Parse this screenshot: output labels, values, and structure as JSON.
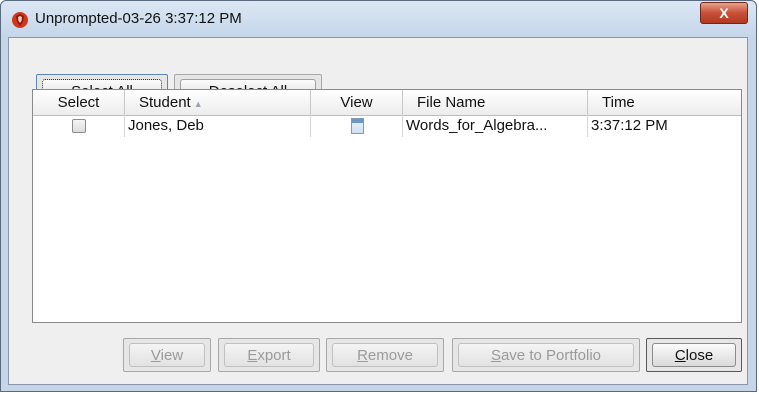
{
  "window": {
    "title": "Unprompted-03-26 3:37:12 PM",
    "close_label": "X",
    "app_icon": "ti-nspire-logo-icon"
  },
  "toolbar": {
    "select_all_pre": "Select ",
    "select_all_mn": "A",
    "select_all_post": "ll",
    "deselect_all_mn": "D",
    "deselect_all_post": "eselect All"
  },
  "table": {
    "columns": {
      "select": "Select",
      "student": "Student",
      "student_sort": "▲",
      "view": "View",
      "file_name": "File Name",
      "time": "Time"
    },
    "rows": [
      {
        "selected": false,
        "student": "Jones, Deb",
        "view_icon": "document-icon",
        "file_name": "Words_for_Algebra...",
        "time": "3:37:12 PM"
      }
    ]
  },
  "footer": {
    "view_mn": "V",
    "view_post": "iew",
    "export_mn": "E",
    "export_post": "xport",
    "remove_mn": "R",
    "remove_post": "emove",
    "save_mn": "S",
    "save_post": "ave to Portfolio",
    "close_mn": "C",
    "close_post": "lose"
  },
  "colors": {
    "title_bar": "#c5d6ea",
    "close_button": "#c75037",
    "client_bg": "#efefef"
  }
}
